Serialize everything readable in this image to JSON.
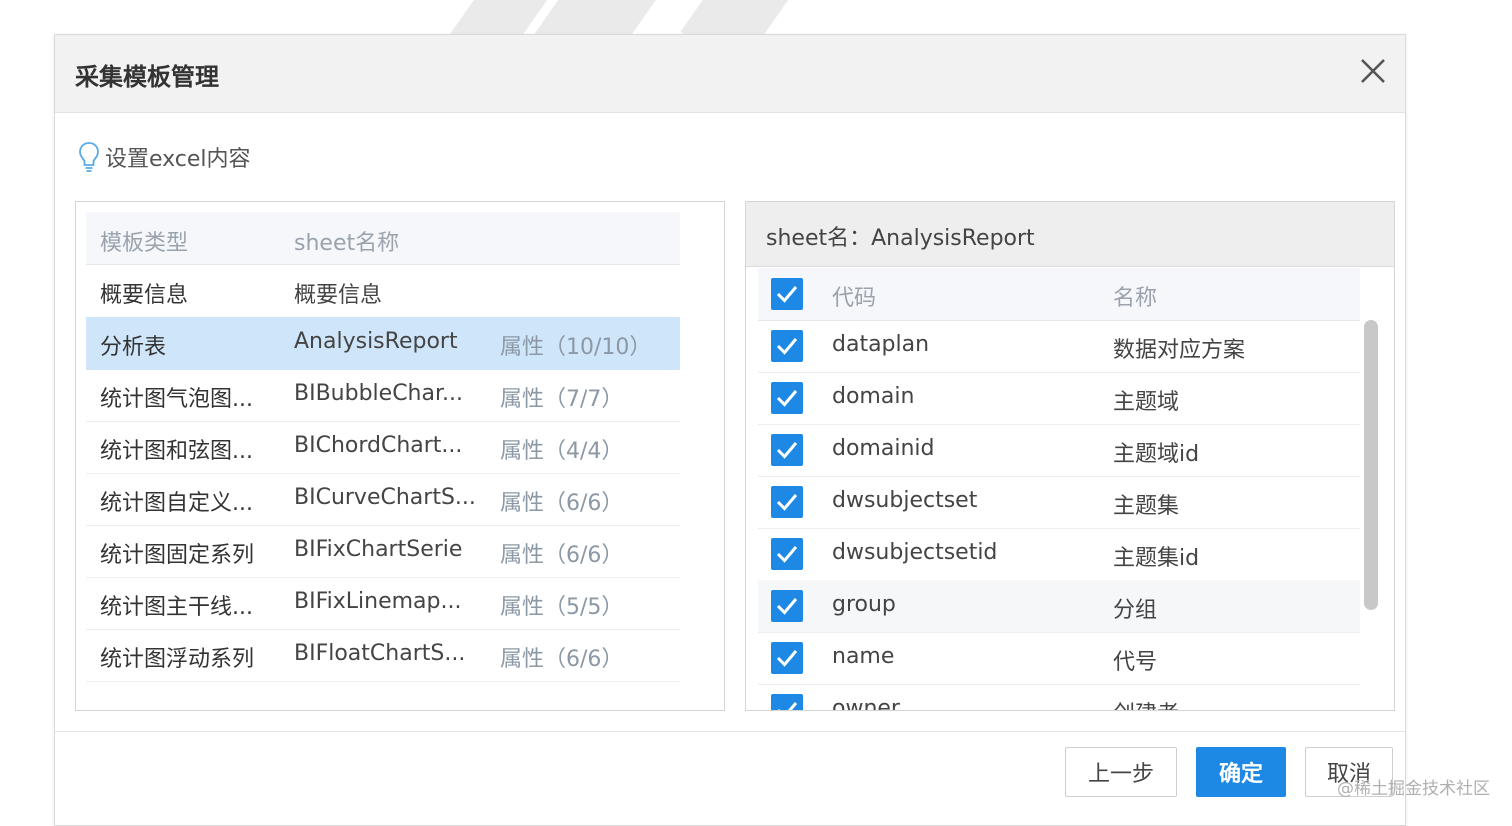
{
  "dialog": {
    "title": "采集模板管理",
    "hint": "设置excel内容"
  },
  "left_table": {
    "headers": {
      "type": "模板类型",
      "sheet": "sheet名称"
    },
    "rows": [
      {
        "type": "概要信息",
        "sheet": "概要信息",
        "attr": ""
      },
      {
        "type": "分析表",
        "sheet": "AnalysisReport",
        "attr": "属性（10/10）"
      },
      {
        "type": "统计图气泡图...",
        "sheet": "BIBubbleChar...",
        "attr": "属性（7/7）"
      },
      {
        "type": "统计图和弦图...",
        "sheet": "BIChordChart...",
        "attr": "属性（4/4）"
      },
      {
        "type": "统计图自定义...",
        "sheet": "BICurveChartS...",
        "attr": "属性（6/6）"
      },
      {
        "type": "统计图固定系列",
        "sheet": "BIFixChartSerie",
        "attr": "属性（6/6）"
      },
      {
        "type": "统计图主干线...",
        "sheet": "BIFixLinemap...",
        "attr": "属性（5/5）"
      },
      {
        "type": "统计图浮动系列",
        "sheet": "BIFloatChartS...",
        "attr": "属性（6/6）"
      }
    ],
    "selected_index": 1
  },
  "right_table": {
    "title": "sheet名：AnalysisReport",
    "headers": {
      "code": "代码",
      "name": "名称"
    },
    "rows": [
      {
        "code": "dataplan",
        "name": "数据对应方案",
        "checked": true
      },
      {
        "code": "domain",
        "name": "主题域",
        "checked": true
      },
      {
        "code": "domainid",
        "name": "主题域id",
        "checked": true
      },
      {
        "code": "dwsubjectset",
        "name": "主题集",
        "checked": true
      },
      {
        "code": "dwsubjectsetid",
        "name": "主题集id",
        "checked": true
      },
      {
        "code": "group",
        "name": "分组",
        "checked": true
      },
      {
        "code": "name",
        "name": "代号",
        "checked": true
      },
      {
        "code": "owner",
        "name": "创建者",
        "checked": true
      }
    ]
  },
  "buttons": {
    "prev": "上一步",
    "ok": "确定",
    "cancel": "取消"
  },
  "watermark": "@稀土掘金技术社区",
  "colors": {
    "accent": "#1e88e5",
    "selected_row": "#cfe6fa"
  }
}
